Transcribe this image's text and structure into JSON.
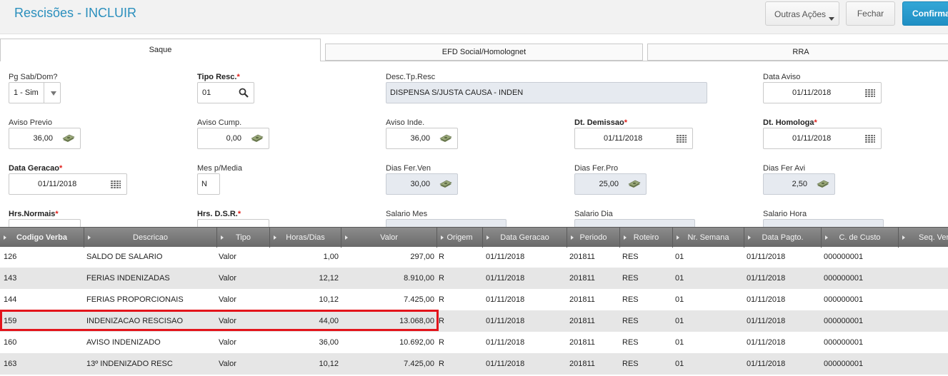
{
  "header": {
    "title": "Rescisões - INCLUIR",
    "buttons": {
      "outras_acoes": "Outras Ações",
      "fechar": "Fechar",
      "confirmar": "Confirmar"
    }
  },
  "tabs": [
    "Saque",
    "EFD Social/Homolognet",
    "RRA"
  ],
  "form": {
    "pg_sab_dom": {
      "label": "Pg Sab/Dom?",
      "value": "1 - Sim"
    },
    "tipo_resc": {
      "label": "Tipo Resc.",
      "value": "01",
      "required": "*"
    },
    "desc_tp_resc": {
      "label": "Desc.Tp.Resc",
      "value": "DISPENSA S/JUSTA CAUSA - INDEN"
    },
    "data_aviso": {
      "label": "Data Aviso",
      "value": "01/11/2018"
    },
    "aviso_previo": {
      "label": "Aviso Previo",
      "value": "36,00"
    },
    "aviso_cump": {
      "label": "Aviso Cump.",
      "value": "0,00"
    },
    "aviso_inde": {
      "label": "Aviso Inde.",
      "value": "36,00"
    },
    "dt_demissao": {
      "label": "Dt. Demissao",
      "value": "01/11/2018",
      "required": "*"
    },
    "dt_homologa": {
      "label": "Dt. Homologa",
      "value": "01/11/2018",
      "required": "*"
    },
    "data_geracao": {
      "label": "Data Geracao",
      "value": "01/11/2018",
      "required": "*"
    },
    "mes_p_media": {
      "label": "Mes p/Media",
      "value": "N"
    },
    "dias_fer_ven": {
      "label": "Dias Fer.Ven",
      "value": "30,00"
    },
    "dias_fer_pro": {
      "label": "Dias Fer.Pro",
      "value": "25,00"
    },
    "dias_fer_avi": {
      "label": "Dias Fer Avi",
      "value": "2,50"
    },
    "hrs_normais": {
      "label": "Hrs.Normais",
      "required": "*"
    },
    "hrs_dsr": {
      "label": "Hrs. D.S.R.",
      "required": "*"
    },
    "salario_mes": {
      "label": "Salario Mes"
    },
    "salario_dia": {
      "label": "Salario Dia"
    },
    "salario_hora": {
      "label": "Salario Hora"
    }
  },
  "grid": {
    "columns": [
      "Codigo Verba",
      "Descricao",
      "Tipo",
      "Horas/Dias",
      "Valor",
      "Origem",
      "Data Geracao",
      "Periodo",
      "Roteiro",
      "Nr. Semana",
      "Data Pagto.",
      "C. de Custo",
      "Seq. Verba"
    ],
    "rows": [
      [
        "126",
        "SALDO DE SALARIO",
        "Valor",
        "1,00",
        "297,00",
        "R",
        "01/11/2018",
        "201811",
        "RES",
        "01",
        "01/11/2018",
        "000000001"
      ],
      [
        "143",
        "FERIAS INDENIZADAS",
        "Valor",
        "12,12",
        "8.910,00",
        "R",
        "01/11/2018",
        "201811",
        "RES",
        "01",
        "01/11/2018",
        "000000001"
      ],
      [
        "144",
        "FERIAS PROPORCIONAIS",
        "Valor",
        "10,12",
        "7.425,00",
        "R",
        "01/11/2018",
        "201811",
        "RES",
        "01",
        "01/11/2018",
        "000000001"
      ],
      [
        "159",
        "INDENIZACAO RESCISAO",
        "Valor",
        "44,00",
        "13.068,00",
        "R",
        "01/11/2018",
        "201811",
        "RES",
        "01",
        "01/11/2018",
        "000000001"
      ],
      [
        "160",
        "AVISO INDENIZADO",
        "Valor",
        "36,00",
        "10.692,00",
        "R",
        "01/11/2018",
        "201811",
        "RES",
        "01",
        "01/11/2018",
        "000000001"
      ],
      [
        "163",
        "13º INDENIZADO RESC",
        "Valor",
        "10,12",
        "7.425,00",
        "R",
        "01/11/2018",
        "201811",
        "RES",
        "01",
        "01/11/2018",
        "000000001"
      ]
    ]
  },
  "colors": {
    "accent": "#2a8fbd",
    "confirm": "#1f8fc4",
    "required": "#e0201b",
    "highlight": "#e3141b"
  }
}
